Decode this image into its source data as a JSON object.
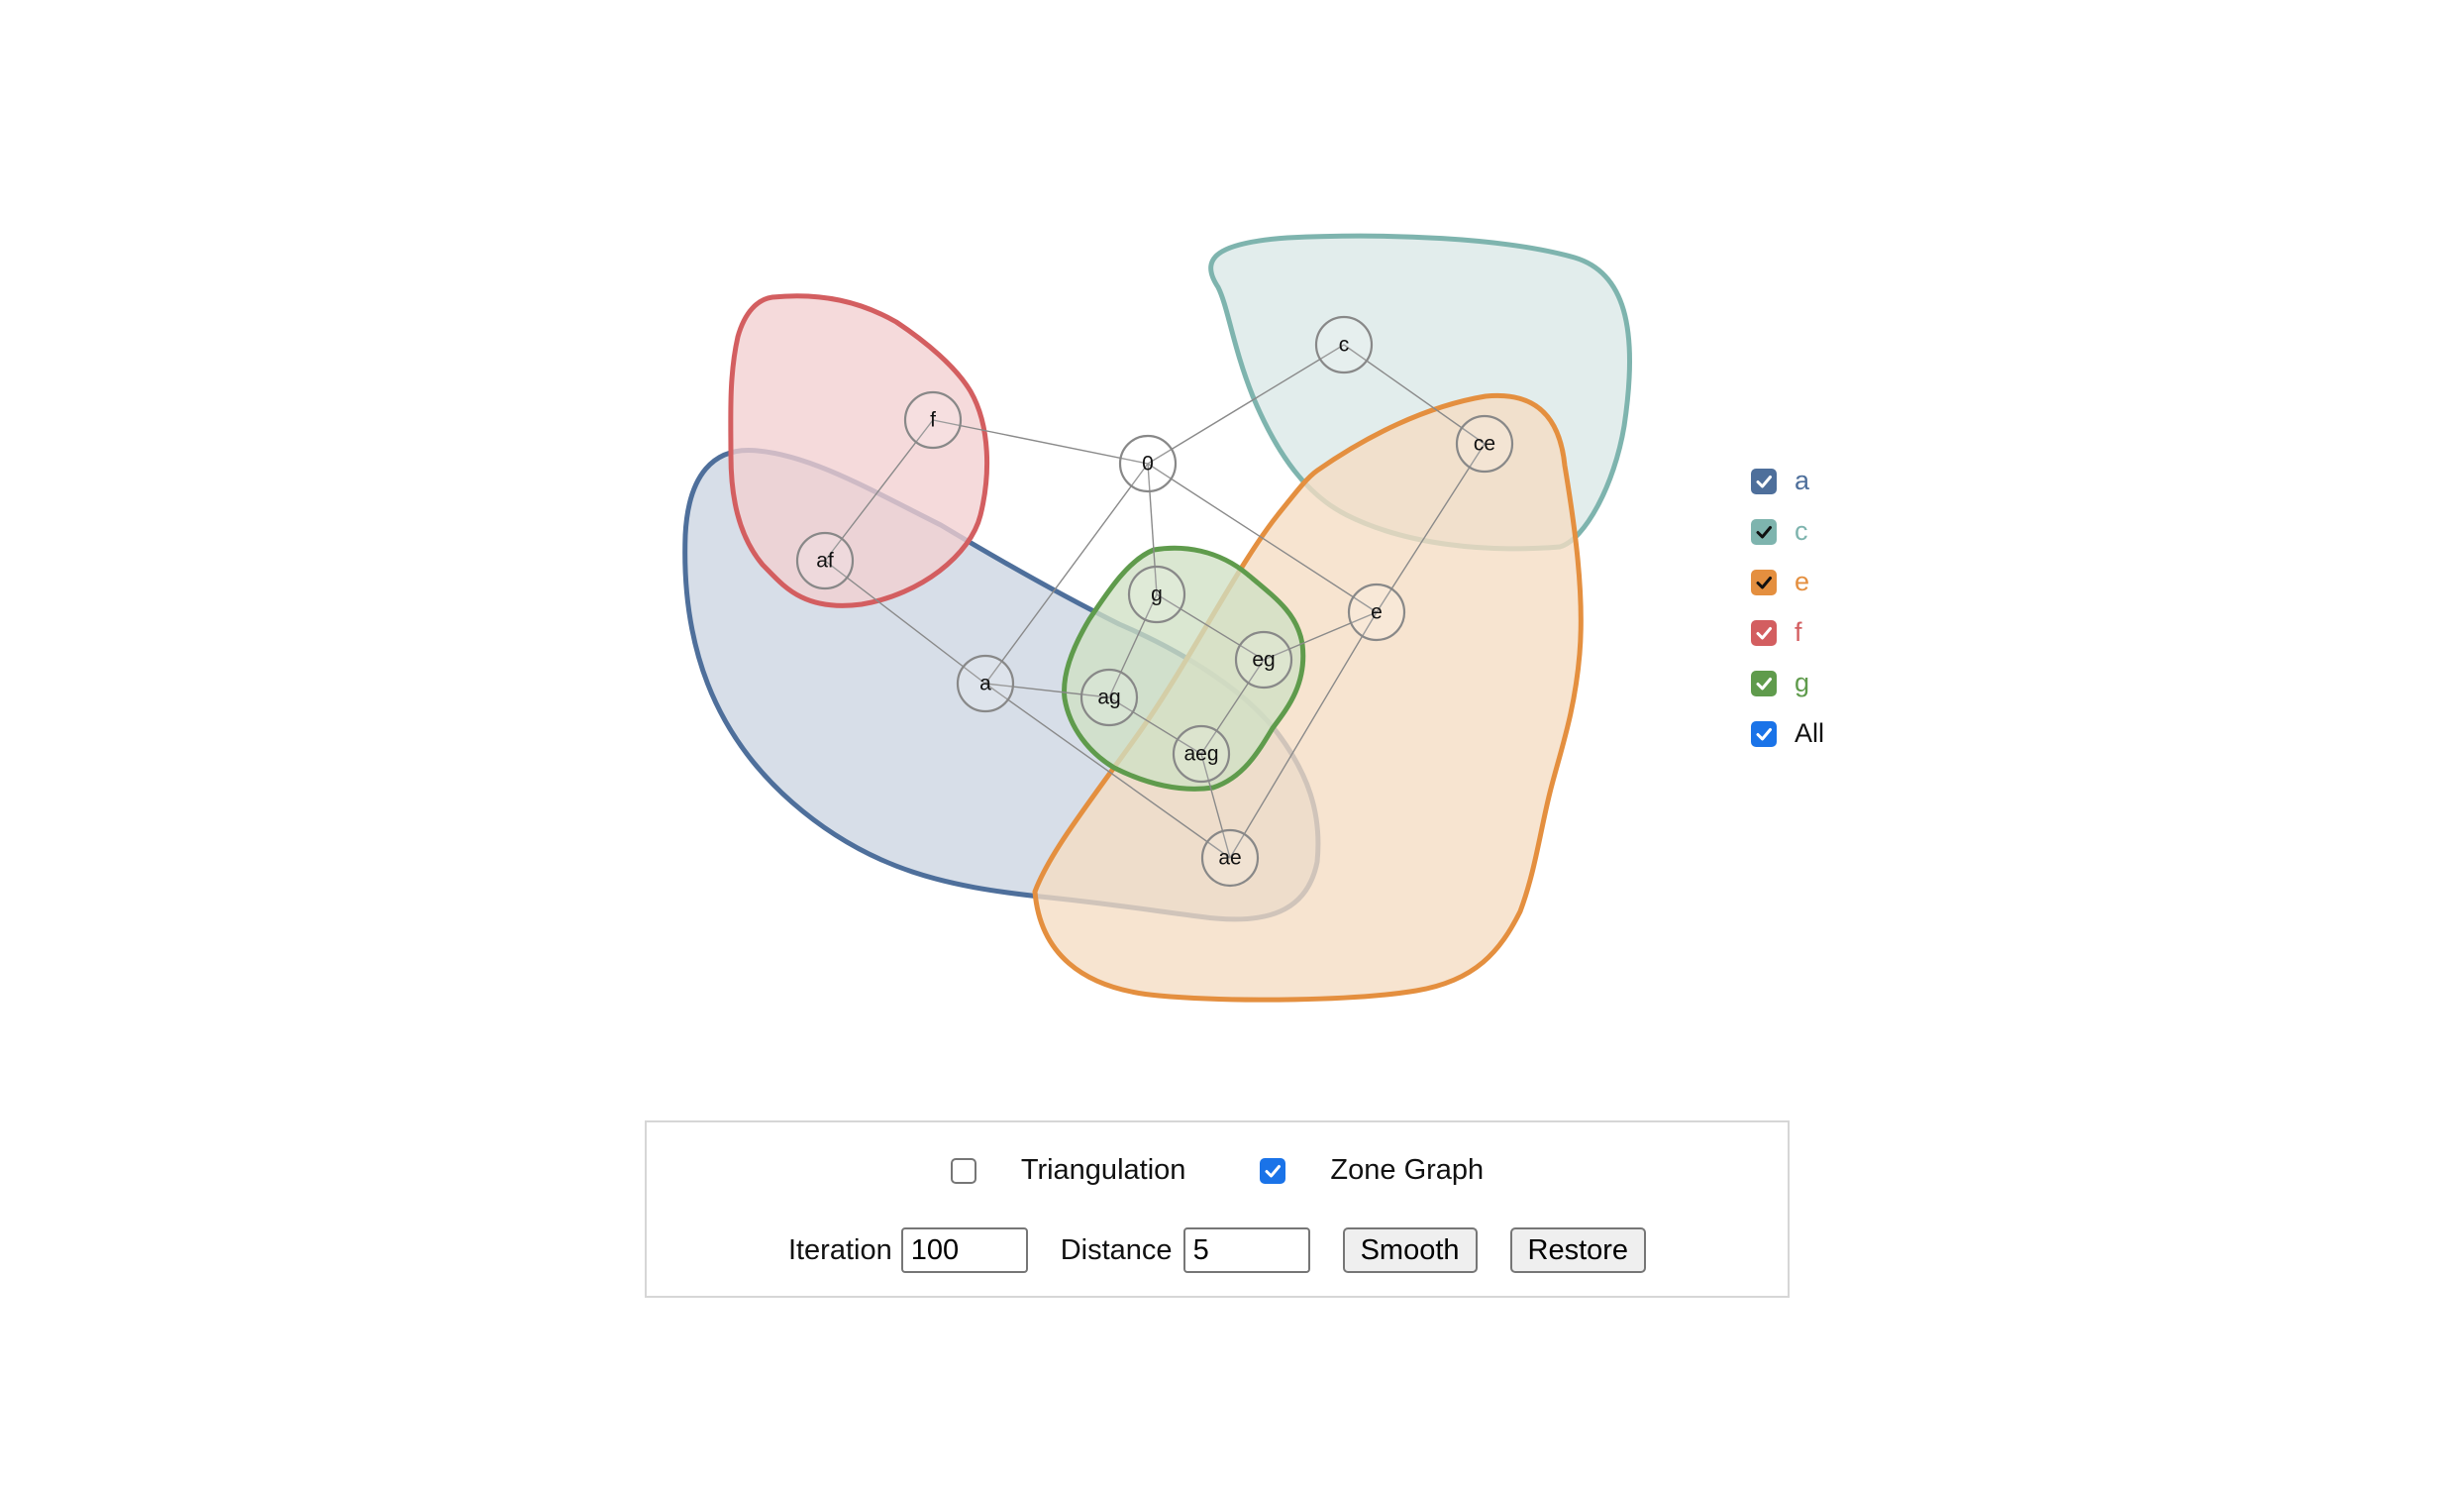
{
  "zones": [
    {
      "id": "a",
      "label": "a",
      "checked": true,
      "color": "#4e6f9b",
      "fill": "#ccd5e2"
    },
    {
      "id": "c",
      "label": "c",
      "checked": true,
      "color": "#7eb4ae",
      "fill": "#dae8e7"
    },
    {
      "id": "e",
      "label": "e",
      "checked": true,
      "color": "#e48f3f",
      "fill": "#f5dcc3"
    },
    {
      "id": "f",
      "label": "f",
      "checked": true,
      "color": "#d35e60",
      "fill": "#f2d0d1"
    },
    {
      "id": "g",
      "label": "g",
      "checked": true,
      "color": "#5f9b4c",
      "fill": "#cfe0c4"
    }
  ],
  "legend_all": {
    "label": "All",
    "checked": true,
    "color": "#111111"
  },
  "nodes": [
    "0",
    "c",
    "ce",
    "f",
    "af",
    "g",
    "eg",
    "e",
    "a",
    "ag",
    "aeg",
    "ae"
  ],
  "edges": [
    [
      "f",
      "0"
    ],
    [
      "0",
      "c"
    ],
    [
      "c",
      "ce"
    ],
    [
      "0",
      "g"
    ],
    [
      "0",
      "e"
    ],
    [
      "0",
      "a"
    ],
    [
      "f",
      "af"
    ],
    [
      "af",
      "a"
    ],
    [
      "a",
      "ag"
    ],
    [
      "a",
      "ae"
    ],
    [
      "g",
      "eg"
    ],
    [
      "g",
      "ag"
    ],
    [
      "eg",
      "e"
    ],
    [
      "eg",
      "aeg"
    ],
    [
      "ag",
      "aeg"
    ],
    [
      "aeg",
      "ae"
    ],
    [
      "ae",
      "e"
    ],
    [
      "e",
      "ce"
    ]
  ],
  "controls": {
    "triangulation": {
      "label": "Triangulation",
      "checked": false
    },
    "zone_graph": {
      "label": "Zone Graph",
      "checked": true
    },
    "iteration": {
      "label": "Iteration",
      "value": "100"
    },
    "distance": {
      "label": "Distance",
      "value": "5"
    },
    "smooth_label": "Smooth",
    "restore_label": "Restore"
  }
}
